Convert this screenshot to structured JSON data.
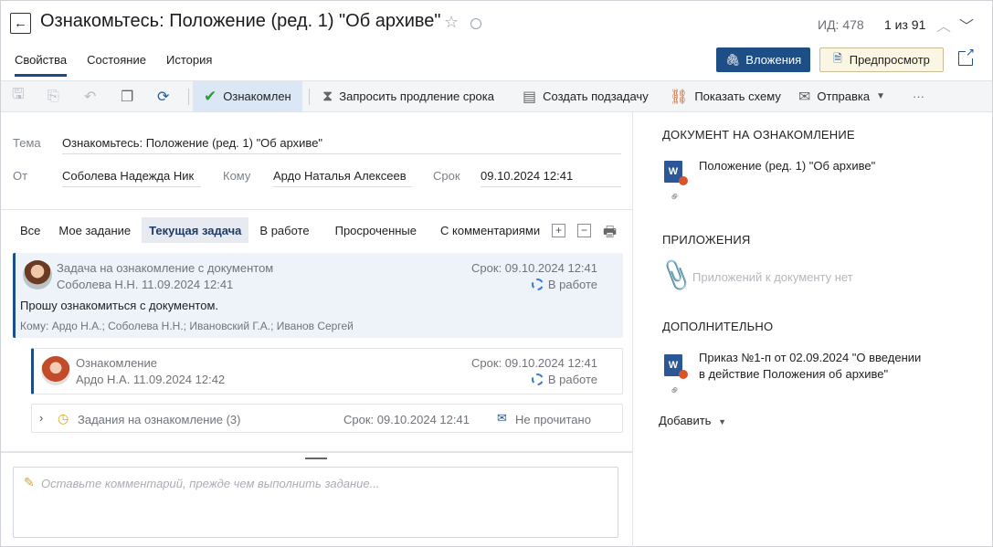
{
  "header": {
    "title": "Ознакомьтесь: Положение (ред. 1) \"Об архиве\"",
    "id_label": "ИД: 478",
    "pager": "1 из 91",
    "back_icon": "arrow-left-icon",
    "star_icon": "star-outline-icon"
  },
  "tabs": [
    {
      "label": "Свойства",
      "active": true
    },
    {
      "label": "Состояние",
      "active": false
    },
    {
      "label": "История",
      "active": false
    }
  ],
  "buttons": {
    "attachments": "Вложения",
    "preview": "Предпросмотр"
  },
  "toolbar": {
    "acknowledged": "Ознакомлен",
    "request_extension": "Запросить продление срока",
    "create_subtask": "Создать подзадачу",
    "show_scheme": "Показать схему",
    "send": "Отправка",
    "more": "···"
  },
  "form": {
    "subject_label": "Тема",
    "subject_value": "Ознакомьтесь: Положение (ред. 1) \"Об архиве\"",
    "from_label": "От",
    "from_value": "Соболева Надежда Ник",
    "to_label": "Кому",
    "to_value": "Ардо Наталья Алексеев",
    "deadline_label": "Срок",
    "deadline_value": "09.10.2024 12:41"
  },
  "filters": [
    {
      "label": "Все",
      "active": false
    },
    {
      "label": "Мое задание",
      "active": false
    },
    {
      "label": "Текущая задача",
      "active": true
    },
    {
      "label": "В работе",
      "active": false
    },
    {
      "label": "Просроченные",
      "active": false
    },
    {
      "label": "С комментариями",
      "active": false
    }
  ],
  "task": {
    "title": "Задача на ознакомление с документом",
    "author_date": "Соболева Н.Н.  11.09.2024 12:41",
    "deadline": "Срок: 09.10.2024 12:41",
    "status": "В работе",
    "body": "Прошу ознакомиться с документом.",
    "recipients": "Кому: Ардо Н.А.; Соболева Н.Н.; Ивановский Г.А.; Иванов Сергей"
  },
  "subtask": {
    "title": "Ознакомление",
    "author_date": "Ардо Н.А.  11.09.2024 12:42",
    "deadline": "Срок: 09.10.2024 12:41",
    "status": "В работе"
  },
  "tasks_group": {
    "label": "Задания на ознакомление (3)",
    "deadline": "Срок: 09.10.2024 12:41",
    "status": "Не прочитано"
  },
  "comment": {
    "placeholder": "Оставьте комментарий, прежде чем выполнить задание..."
  },
  "right": {
    "doc_section": "ДОКУМЕНТ НА ОЗНАКОМЛЕНИЕ",
    "doc_name": "Положение (ред. 1) \"Об архиве\"",
    "attachments_section": "ПРИЛОЖЕНИЯ",
    "attachments_empty": "Приложений к документу нет",
    "extra_section": "ДОПОЛНИТЕЛЬНО",
    "extra_doc_line1": "Приказ №1-п от 02.09.2024 \"О введении",
    "extra_doc_line2": "в действие Положения об архиве\"",
    "add_label": "Добавить",
    "word_letter": "W"
  }
}
